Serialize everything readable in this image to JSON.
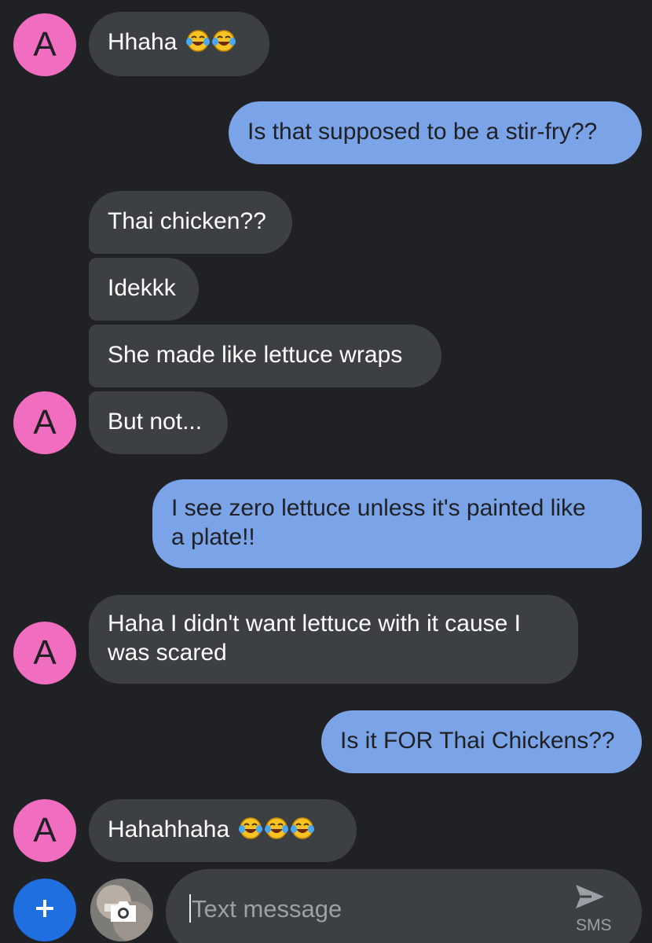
{
  "contact": {
    "initial": "A",
    "avatar_color": "#f06dbf"
  },
  "colors": {
    "background": "#202124",
    "incoming_bubble": "#3c4043",
    "outgoing_bubble": "#7ba3e8",
    "attach_button": "#1f6fe0"
  },
  "messages": [
    {
      "direction": "incoming",
      "text": "Hhaha",
      "emoji": [
        "face-with-tears-of-joy",
        "face-with-tears-of-joy"
      ]
    },
    {
      "direction": "outgoing",
      "text": "Is that supposed to be a stir-fry??"
    },
    {
      "direction": "incoming",
      "text": "Thai chicken??"
    },
    {
      "direction": "incoming",
      "text": "Idekkk"
    },
    {
      "direction": "incoming",
      "text": "She made like lettuce wraps"
    },
    {
      "direction": "incoming",
      "text": "But not..."
    },
    {
      "direction": "outgoing",
      "text": "I see zero lettuce unless it's painted like",
      "text_line2": "a plate!!"
    },
    {
      "direction": "incoming",
      "text": "Haha I didn't want lettuce with it cause I",
      "text_line2": "was scared"
    },
    {
      "direction": "outgoing",
      "text": "Is it FOR Thai Chickens??"
    },
    {
      "direction": "incoming",
      "text": "Hahahhaha",
      "emoji": [
        "face-with-tears-of-joy",
        "face-with-tears-of-joy",
        "face-with-tears-of-joy"
      ]
    }
  ],
  "compose": {
    "placeholder": "Text message",
    "send_label": "SMS",
    "plus_icon": "plus-icon",
    "gallery_icon": "camera-icon",
    "send_icon": "send-icon"
  }
}
